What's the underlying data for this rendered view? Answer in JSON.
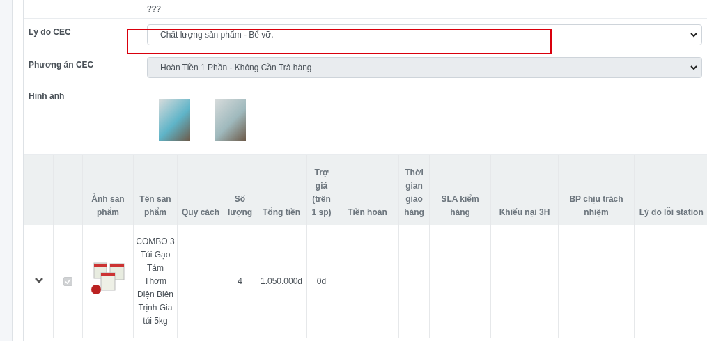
{
  "note_text": "???",
  "fields": [
    {
      "label": "Lý do CEC",
      "value": "Chất lượng sản phẩm - Bể vỡ.",
      "disabled": false,
      "highlighted": true
    },
    {
      "label": "Phương án CEC",
      "value": "Hoàn Tiền 1 Phần - Không Cần Trả hàng",
      "disabled": true,
      "highlighted": false
    }
  ],
  "images": {
    "label": "Hình ảnh",
    "photos": [
      {
        "kind": "photo"
      },
      {
        "kind": "photo"
      }
    ]
  },
  "table": {
    "columns": [
      "Ảnh sản phẩm",
      "Tên sản phẩm",
      "Quy cách",
      "Số lượng",
      "Tổng tiền",
      "Trợ giá (trên 1 sp)",
      "Tiền hoàn",
      "Thời gian giao hàng",
      "SLA kiểm hàng",
      "Khiếu nại 3H",
      "BP chịu trách nhiệm",
      "Lý do lỗi station"
    ],
    "rows": [
      {
        "expanded": false,
        "checked": true,
        "checkbox_disabled": true,
        "product_name": "COMBO 3 Túi Gạo Tám Thơm Điện Biên Trịnh Gia túi 5kg",
        "quantity": "4",
        "total": "1.050.000đ",
        "subsidy": "0đ"
      }
    ]
  }
}
